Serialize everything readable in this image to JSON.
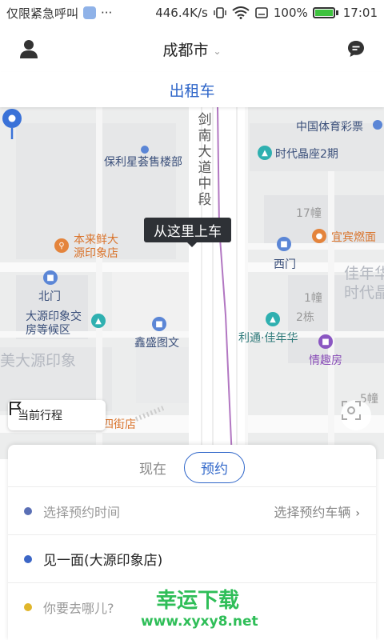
{
  "status_bar": {
    "carrier": "仅限紧急呼叫",
    "more": "···",
    "net_speed": "446.4K/s",
    "battery": "100%",
    "time": "17:01"
  },
  "header": {
    "city": "成都市",
    "avatar_icon": "user-icon",
    "chat_icon": "chat-icon"
  },
  "tabs": [
    {
      "label": "出租车"
    }
  ],
  "map": {
    "road_name": "剑南大道中段",
    "labels": {
      "china_lottery": "中国体育彩票",
      "baoli": "保利星荟售楼部",
      "times_plaza": "时代晶座2期",
      "bldg17": "17幢",
      "benlai_1": "本来鲜大",
      "benlai_2": "源印象店",
      "yibin": "宜宾燃面",
      "xi_men": "西门",
      "jianian_1": "佳年华",
      "jianian_2": "时代晶",
      "bei_men": "北门",
      "bldg1": "1幢",
      "bldg2": "2栋",
      "dayuan_1": "大源印象交",
      "dayuan_2": "房等候区",
      "meidayuan": "美大源印象",
      "xinsheng": "鑫盛图文",
      "litong": "利通·佳年华",
      "qingqu": "情趣房",
      "bldg5": "5幢",
      "sijie": "四街店"
    },
    "pickup_tooltip": "从这里上车",
    "trip_button": "当前行程"
  },
  "booking": {
    "mode_now": "现在",
    "mode_reserve": "预约",
    "time_placeholder": "选择预约时间",
    "vehicle_placeholder": "选择预约车辆",
    "start": "见一面(大源印象店)",
    "dest_placeholder": "你要去哪儿?"
  },
  "watermark": {
    "title": "幸运下载",
    "site": "www.xyxy8.net"
  },
  "colors": {
    "accent": "#2f66c9",
    "tooltip_bg": "#2e3136",
    "watermark": "#2fbe58"
  }
}
